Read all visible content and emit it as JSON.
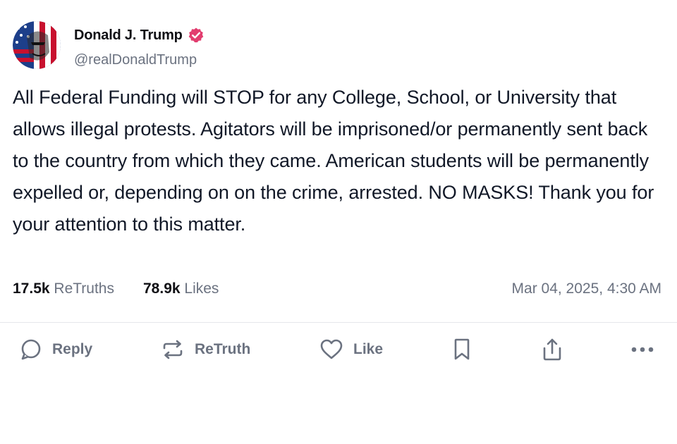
{
  "post": {
    "author": {
      "display_name": "Donald J. Trump",
      "handle": "@realDonaldTrump",
      "verified": true,
      "verified_color": "#e23d6f"
    },
    "text": "All Federal Funding will STOP for any College, School, or University that allows illegal protests. Agitators will be imprisoned/or permanently sent back to the country from which they came. American students will be permanently expelled or, depending on on the crime, arrested. NO MASKS! Thank you for your attention to this matter.",
    "stats": {
      "retruths_count": "17.5k",
      "retruths_label": "ReTruths",
      "likes_count": "78.9k",
      "likes_label": "Likes"
    },
    "timestamp": "Mar 04, 2025, 4:30 AM"
  },
  "actions": {
    "reply_label": "Reply",
    "retruth_label": "ReTruth",
    "like_label": "Like",
    "icons": [
      "reply-icon",
      "retruth-icon",
      "like-icon",
      "bookmark-icon",
      "share-icon",
      "more-icon"
    ]
  },
  "colors": {
    "text": "#111827",
    "muted": "#6b7280",
    "divider": "#e5e7eb"
  }
}
